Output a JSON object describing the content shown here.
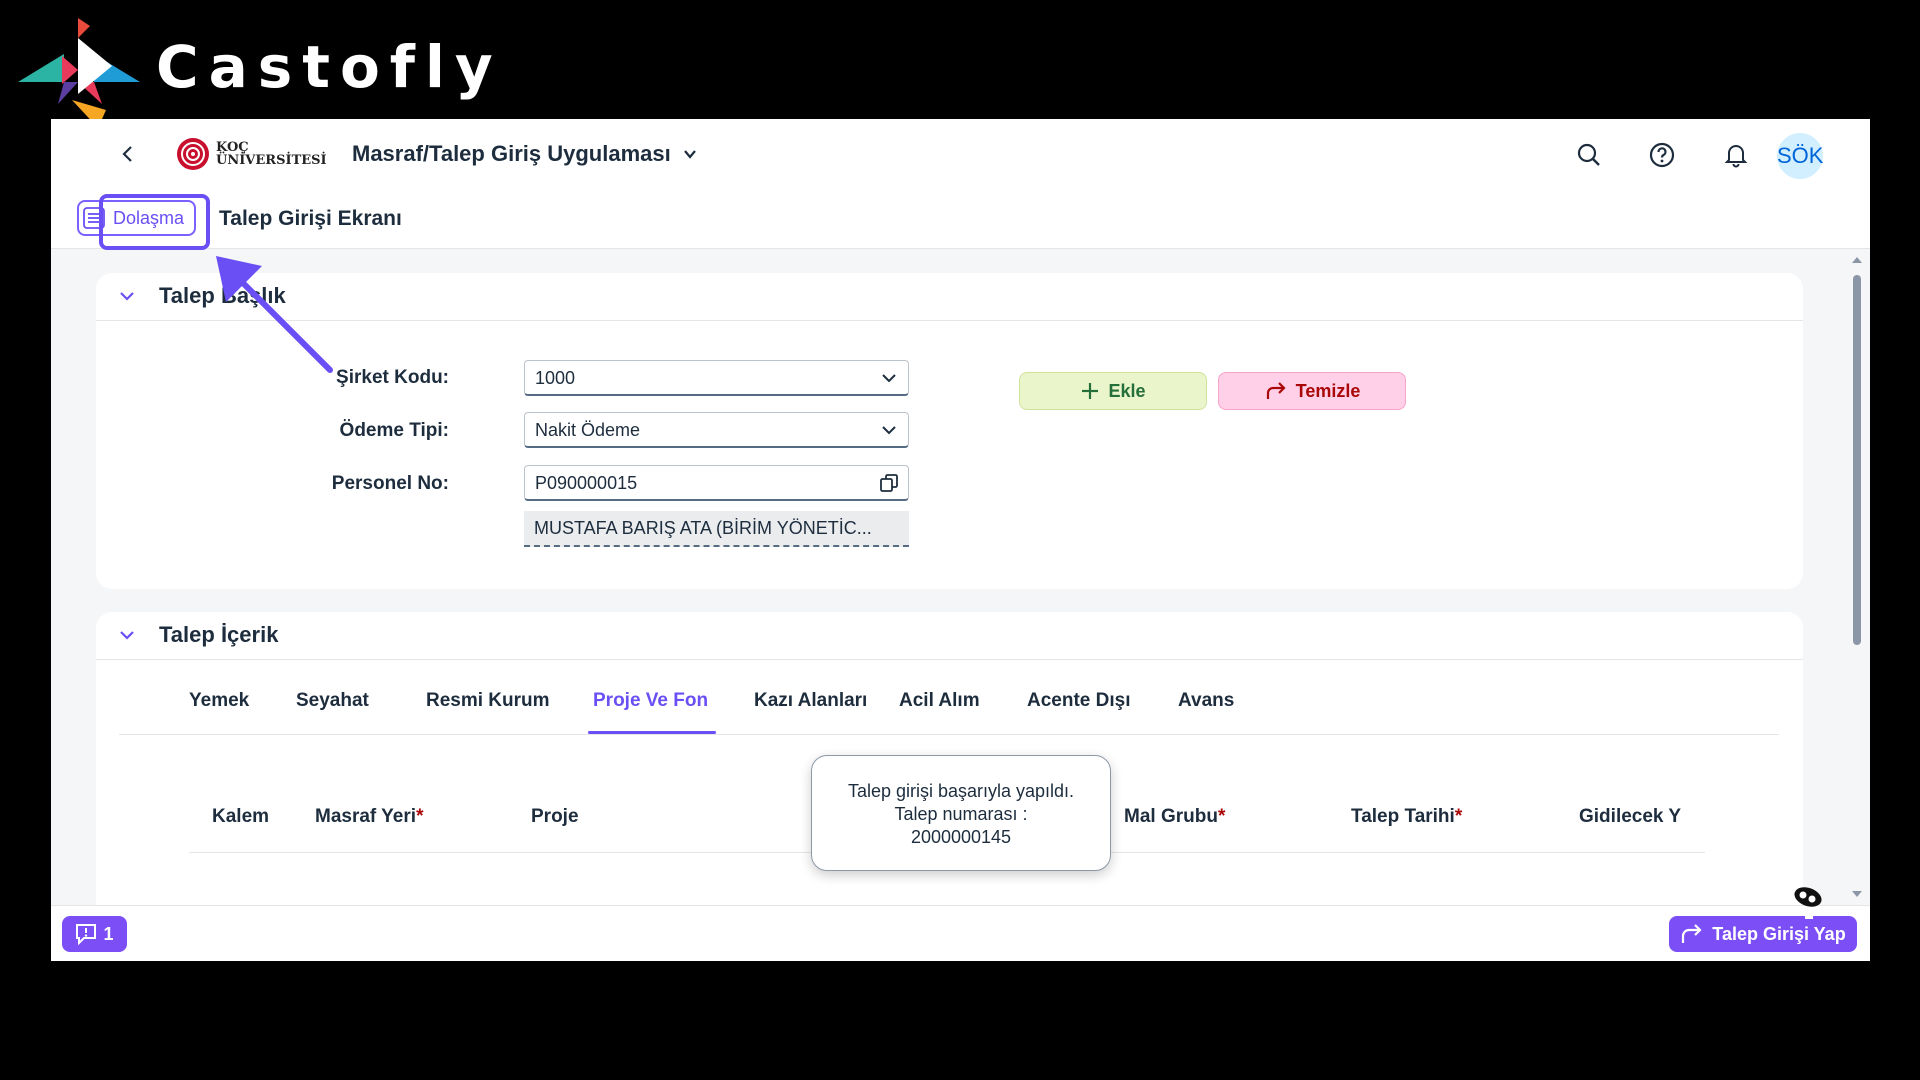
{
  "brand": {
    "name": "Castofly"
  },
  "shell": {
    "org_line1": "KOÇ",
    "org_line2": "ÜNİVERSİTESİ",
    "app_title": "Masraf/Talep Giriş Uygulaması",
    "avatar_initials": "SÖK"
  },
  "subheader": {
    "nav_label": "Dolaşma",
    "page_title": "Talep Girişi Ekranı"
  },
  "header_section": {
    "title": "Talep Başlık",
    "fields": {
      "company_label": "Şirket Kodu:",
      "company_value": "1000",
      "payment_label": "Ödeme Tipi:",
      "payment_value": "Nakit Ödeme",
      "personnel_label": "Personel No:",
      "personnel_value": "P090000015",
      "personnel_name": "MUSTAFA BARIŞ  ATA (BİRİM YÖNETİC..."
    },
    "buttons": {
      "add": "Ekle",
      "clear": "Temizle"
    }
  },
  "content_section": {
    "title": "Talep İçerik",
    "tabs": [
      "Yemek",
      "Seyahat",
      "Resmi Kurum",
      "Proje Ve Fon",
      "Kazı Alanları",
      "Acil Alım",
      "Acente Dışı",
      "Avans"
    ],
    "active_tab": "Proje Ve Fon",
    "table_headers": {
      "item": "Kalem",
      "cost_center": "Masraf Yeri",
      "project": "Proje",
      "material_group": "Mal Grubu",
      "request_date": "Talep Tarihi",
      "destination": "Gidilecek Y"
    },
    "required_mark": "*"
  },
  "toast": {
    "line1": "Talep girişi başarıyla yapıldı.",
    "line2": "Talep numarası :",
    "line3": "2000000145"
  },
  "footer": {
    "message_count": "1",
    "submit_label": "Talep Girişi Yap"
  },
  "colors": {
    "accent": "#6a4ff5",
    "add_bg": "#ebf5cb",
    "clear_bg": "#ffd0e7"
  }
}
